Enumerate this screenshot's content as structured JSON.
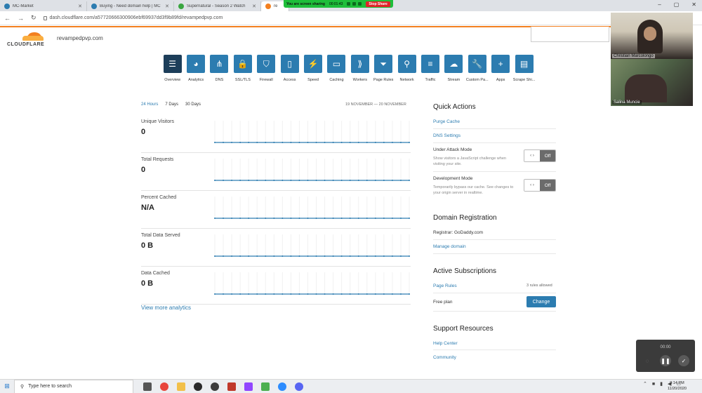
{
  "browser": {
    "tabs": [
      {
        "label": "MC-Market",
        "icon": "mcmarket-icon",
        "color": "#2c7cb0"
      },
      {
        "label": "Buying - Need domain help | MC",
        "icon": "mcmarket-icon",
        "color": "#2c7cb0"
      },
      {
        "label": "Supernatural - Season 2 Watch",
        "icon": "play-icon",
        "color": "#3aa640"
      }
    ],
    "active_tab": {
      "label": "re",
      "icon": "cloudflare-icon",
      "color": "#f38020"
    },
    "url": "dash.cloudflare.com/a57720666300906ebf69937dd3f9b89fd/revampedpvp.com"
  },
  "zoom_share": {
    "text": "You are screen sharing",
    "timer": "00:01:43",
    "stop_label": "Stop Share"
  },
  "cloudflare": {
    "logo_text": "CLOUDFLARE",
    "domain": "revampedpvp.com",
    "nav": [
      {
        "label": "Overview",
        "icon": "clipboard-icon",
        "glyph": "☰",
        "active": true
      },
      {
        "label": "Analytics",
        "icon": "pie-chart-icon",
        "glyph": "◕"
      },
      {
        "label": "DNS",
        "icon": "network-icon",
        "glyph": "⋔"
      },
      {
        "label": "SSL/TLS",
        "icon": "lock-icon",
        "glyph": "🔒"
      },
      {
        "label": "Firewall",
        "icon": "shield-icon",
        "glyph": "⛉"
      },
      {
        "label": "Access",
        "icon": "door-icon",
        "glyph": "▯"
      },
      {
        "label": "Speed",
        "icon": "lightning-icon",
        "glyph": "⚡"
      },
      {
        "label": "Caching",
        "icon": "drive-icon",
        "glyph": "▭"
      },
      {
        "label": "Workers",
        "icon": "workers-icon",
        "glyph": "⟫"
      },
      {
        "label": "Page Rules",
        "icon": "filter-icon",
        "glyph": "⏷"
      },
      {
        "label": "Network",
        "icon": "location-icon",
        "glyph": "⚲"
      },
      {
        "label": "Traffic",
        "icon": "list-icon",
        "glyph": "≡"
      },
      {
        "label": "Stream",
        "icon": "cloud-upload-icon",
        "glyph": "☁"
      },
      {
        "label": "Custom Pa...",
        "icon": "wrench-icon",
        "glyph": "🔧"
      },
      {
        "label": "Apps",
        "icon": "plus-icon",
        "glyph": "+"
      },
      {
        "label": "Scrape Shi...",
        "icon": "document-icon",
        "glyph": "▤"
      }
    ],
    "analytics": {
      "ranges": [
        "24 Hours",
        "7 Days",
        "30 Days"
      ],
      "selected_range": "24 Hours",
      "date_range": "19 NOVEMBER — 20 NOVEMBER",
      "metrics": [
        {
          "label": "Unique Visitors",
          "value": "0"
        },
        {
          "label": "Total Requests",
          "value": "0"
        },
        {
          "label": "Percent Cached",
          "value": "N/A"
        },
        {
          "label": "Total Data Served",
          "value": "0 B"
        },
        {
          "label": "Data Cached",
          "value": "0 B"
        }
      ],
      "view_more": "View more analytics"
    },
    "quick_actions": {
      "title": "Quick Actions",
      "purge_cache": "Purge Cache",
      "dns_settings": "DNS Settings",
      "under_attack": {
        "label": "Under Attack Mode",
        "desc": "Show visitors a JavaScript challenge when visiting your site.",
        "toggle_left": "‹ ›",
        "toggle_state": "Off"
      },
      "dev_mode": {
        "label": "Development Mode",
        "desc": "Temporarily bypass our cache. See changes to your origin server in realtime.",
        "toggle_left": "‹ ›",
        "toggle_state": "Off"
      }
    },
    "domain_registration": {
      "title": "Domain Registration",
      "registrar": "Registrar: GoDaddy.com",
      "manage": "Manage domain"
    },
    "subscriptions": {
      "title": "Active Subscriptions",
      "page_rules": "Page Rules",
      "rules_allowed": "3 rules allowed",
      "plan": "Free plan",
      "change": "Change"
    },
    "support": {
      "title": "Support Resources",
      "help": "Help Center",
      "community": "Community"
    }
  },
  "zoom": {
    "participants": [
      "Christian Marcolongo",
      "Salina Muncie"
    ],
    "recording_time": "00:00"
  },
  "taskbar": {
    "search_placeholder": "Type here to search",
    "time": "9:14 PM",
    "date": "11/20/2020"
  }
}
